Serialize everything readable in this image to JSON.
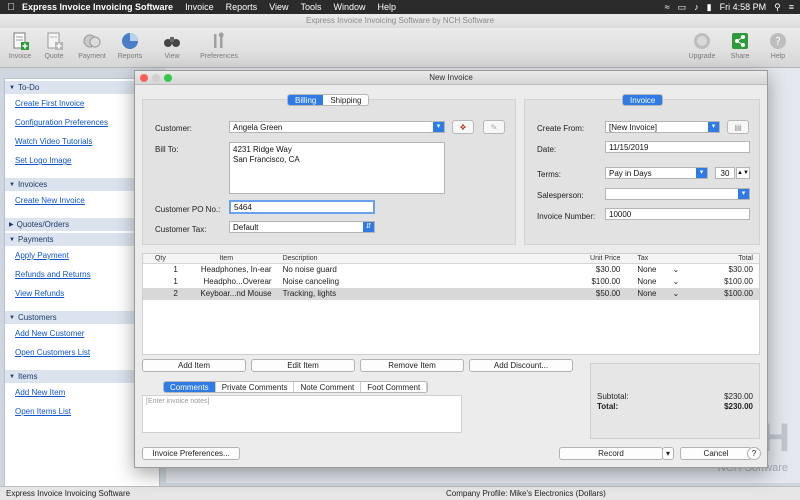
{
  "menubar": {
    "app_name": "Express Invoice Invoicing Software",
    "menus": [
      "Invoice",
      "Reports",
      "View",
      "Tools",
      "Window",
      "Help"
    ],
    "clock": "Fri 4:58 PM"
  },
  "main_window": {
    "title": "Express Invoice Invoicing Software by NCH Software"
  },
  "toolbar": {
    "invoice": "Invoice",
    "quote": "Quote",
    "payment": "Payment",
    "reports": "Reports",
    "view": "View",
    "preferences": "Preferences",
    "upgrade": "Upgrade",
    "share": "Share",
    "help": "Help"
  },
  "sidebar": {
    "todo": {
      "title": "To-Do",
      "items": [
        "Create First Invoice",
        "Configuration Preferences",
        "Watch Video Tutorials",
        "Set Logo Image"
      ]
    },
    "invoices": {
      "title": "Invoices",
      "items": [
        "Create New Invoice"
      ]
    },
    "quotes": {
      "title": "Quotes/Orders"
    },
    "payments": {
      "title": "Payments",
      "items": [
        "Apply Payment",
        "Refunds and Returns",
        "View Refunds"
      ]
    },
    "customers": {
      "title": "Customers",
      "items": [
        "Add New Customer",
        "Open Customers List"
      ]
    },
    "items": {
      "title": "Items",
      "items": [
        "Add New Item",
        "Open Items List"
      ]
    }
  },
  "statusbar": {
    "left": "Express Invoice Invoicing Software",
    "company": "Company Profile: Mike's Electronics (Dollars)"
  },
  "watermark": {
    "big": "H",
    "small": "NCH Software"
  },
  "dialog": {
    "title": "New Invoice",
    "tabs": {
      "billing": "Billing",
      "shipping": "Shipping",
      "invoice": "Invoice"
    },
    "customer_label": "Customer:",
    "customer_value": "Angela Green",
    "bill_to_label": "Bill To:",
    "bill_to_line1": "4231 Ridge Way",
    "bill_to_line2": "San Francisco, CA",
    "po_label": "Customer PO No.:",
    "po_value": "5464",
    "tax_label": "Customer Tax:",
    "tax_value": "Default",
    "create_from_label": "Create From:",
    "create_from_value": "[New Invoice]",
    "date_label": "Date:",
    "date_value": "11/15/2019",
    "terms_label": "Terms:",
    "terms_value": "Pay in Days",
    "terms_days": "30",
    "salesperson_label": "Salesperson:",
    "salesperson_value": "",
    "invoice_number_label": "Invoice Number:",
    "invoice_number_value": "10000",
    "table": {
      "headers": {
        "qty": "Qty",
        "item": "Item",
        "description": "Description",
        "unit_price": "Unit Price",
        "tax": "Tax",
        "total": "Total"
      },
      "rows": [
        {
          "qty": "1",
          "item": "Headphones, In-ear",
          "description": "No noise guard",
          "unit_price": "$30.00",
          "tax": "None",
          "total": "$30.00"
        },
        {
          "qty": "1",
          "item": "Headpho...Overear",
          "description": "Noise canceling",
          "unit_price": "$100.00",
          "tax": "None",
          "total": "$100.00"
        },
        {
          "qty": "2",
          "item": "Keyboar...nd Mouse",
          "description": "Tracking, lights",
          "unit_price": "$50.00",
          "tax": "None",
          "total": "$100.00"
        }
      ]
    },
    "buttons": {
      "add_item": "Add Item",
      "edit_item": "Edit Item",
      "remove_item": "Remove Item",
      "add_discount": "Add Discount...",
      "invoice_preferences": "Invoice Preferences...",
      "record": "Record",
      "cancel": "Cancel",
      "help": "?"
    },
    "notes_tabs": [
      "Comments",
      "Private Comments",
      "Note Comment",
      "Foot Comment"
    ],
    "notes_placeholder": "[Enter invoice notes]",
    "subtotal_label": "Subtotal:",
    "subtotal_value": "$230.00",
    "total_label": "Total:",
    "total_value": "$230.00"
  }
}
